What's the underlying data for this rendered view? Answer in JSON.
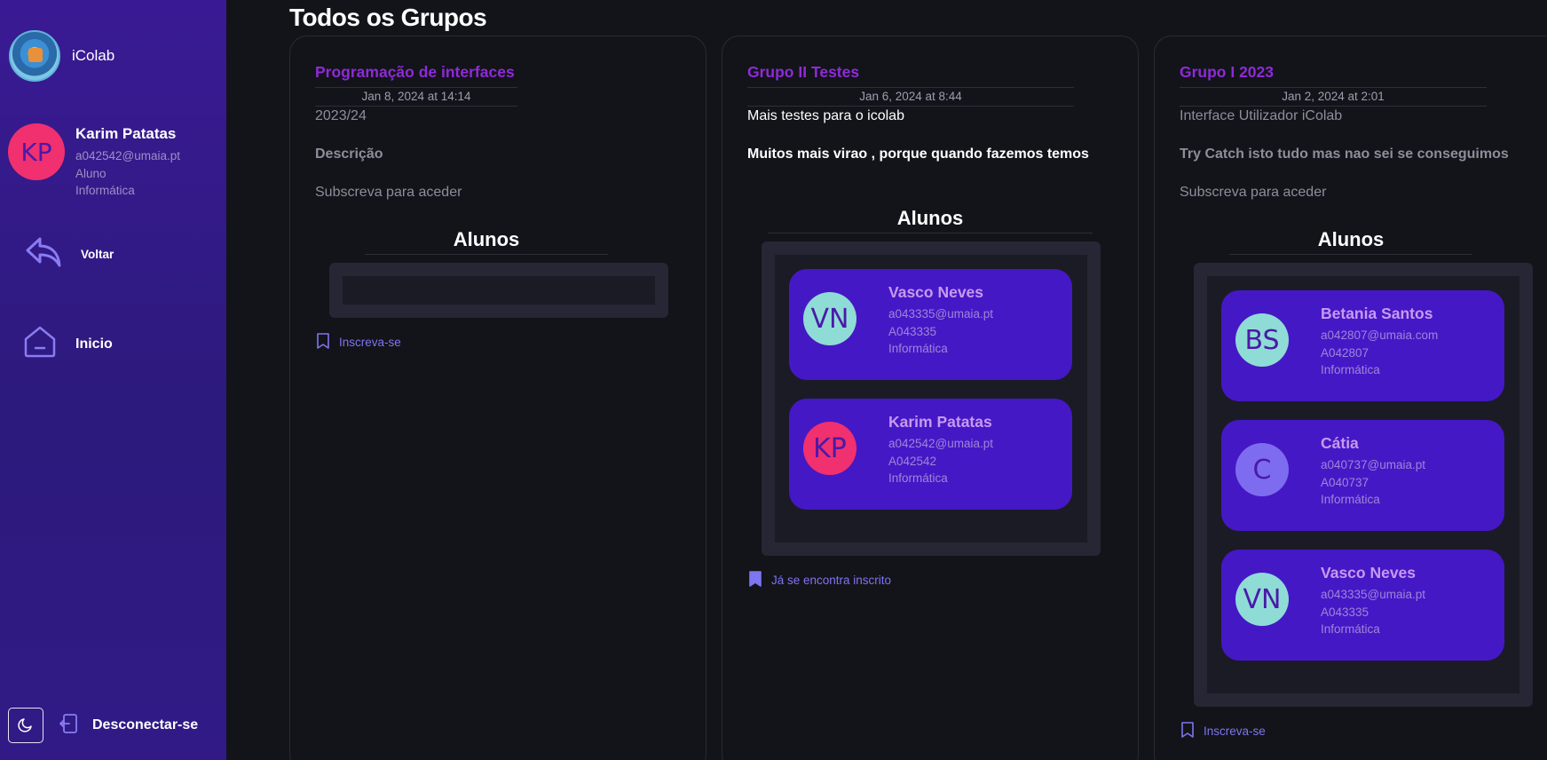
{
  "app": {
    "name": "iColab"
  },
  "user": {
    "initials": "KP",
    "name": "Karim Patatas",
    "email": "a042542@umaia.pt",
    "role": "Aluno",
    "course": "Informática"
  },
  "nav": {
    "back_label": "Voltar",
    "home_label": "Inicio",
    "logout_label": "Desconectar-se"
  },
  "page": {
    "title": "Todos os Grupos"
  },
  "groups": [
    {
      "title": "Programação de interfaces",
      "date": "Jan 8, 2024 at 14:14",
      "subtitle": "2023/24",
      "description": "Descrição",
      "access": "Subscreva para aceder",
      "students_title": "Alunos",
      "action": "Inscreva-se"
    },
    {
      "title": "Grupo II Testes",
      "date": "Jan 6, 2024 at 8:44",
      "subtitle": "Mais testes para o icolab",
      "description": "Muitos mais virao , porque quando fazemos temos",
      "students_title": "Alunos",
      "students": [
        {
          "initials": "VN",
          "name": "Vasco Neves",
          "email": "a043335@umaia.pt",
          "id": "A043335",
          "course": "Informática"
        },
        {
          "initials": "KP",
          "name": "Karim Patatas",
          "email": "a042542@umaia.pt",
          "id": "A042542",
          "course": "Informática"
        }
      ],
      "action": "Já se encontra inscrito"
    },
    {
      "title": "Grupo I 2023",
      "date": "Jan 2, 2024 at 2:01",
      "subtitle": "Interface Utilizador iColab",
      "description": "Try Catch isto tudo mas nao sei se conseguimos",
      "access": "Subscreva para aceder",
      "students_title": "Alunos",
      "students": [
        {
          "initials": "BS",
          "name": "Betania Santos",
          "email": "a042807@umaia.com",
          "id": "A042807",
          "course": "Informática"
        },
        {
          "initials": "C",
          "name": "Cátia",
          "email": "a040737@umaia.pt",
          "id": "A040737",
          "course": "Informática"
        },
        {
          "initials": "VN",
          "name": "Vasco Neves",
          "email": "a043335@umaia.pt",
          "id": "A043335",
          "course": "Informática"
        }
      ],
      "action": "Inscreva-se"
    }
  ],
  "colors": {
    "sidebar": "#3a1a94",
    "accent_title": "#8f2ad8",
    "student_card": "#4518c6",
    "link": "#7d76f0"
  }
}
